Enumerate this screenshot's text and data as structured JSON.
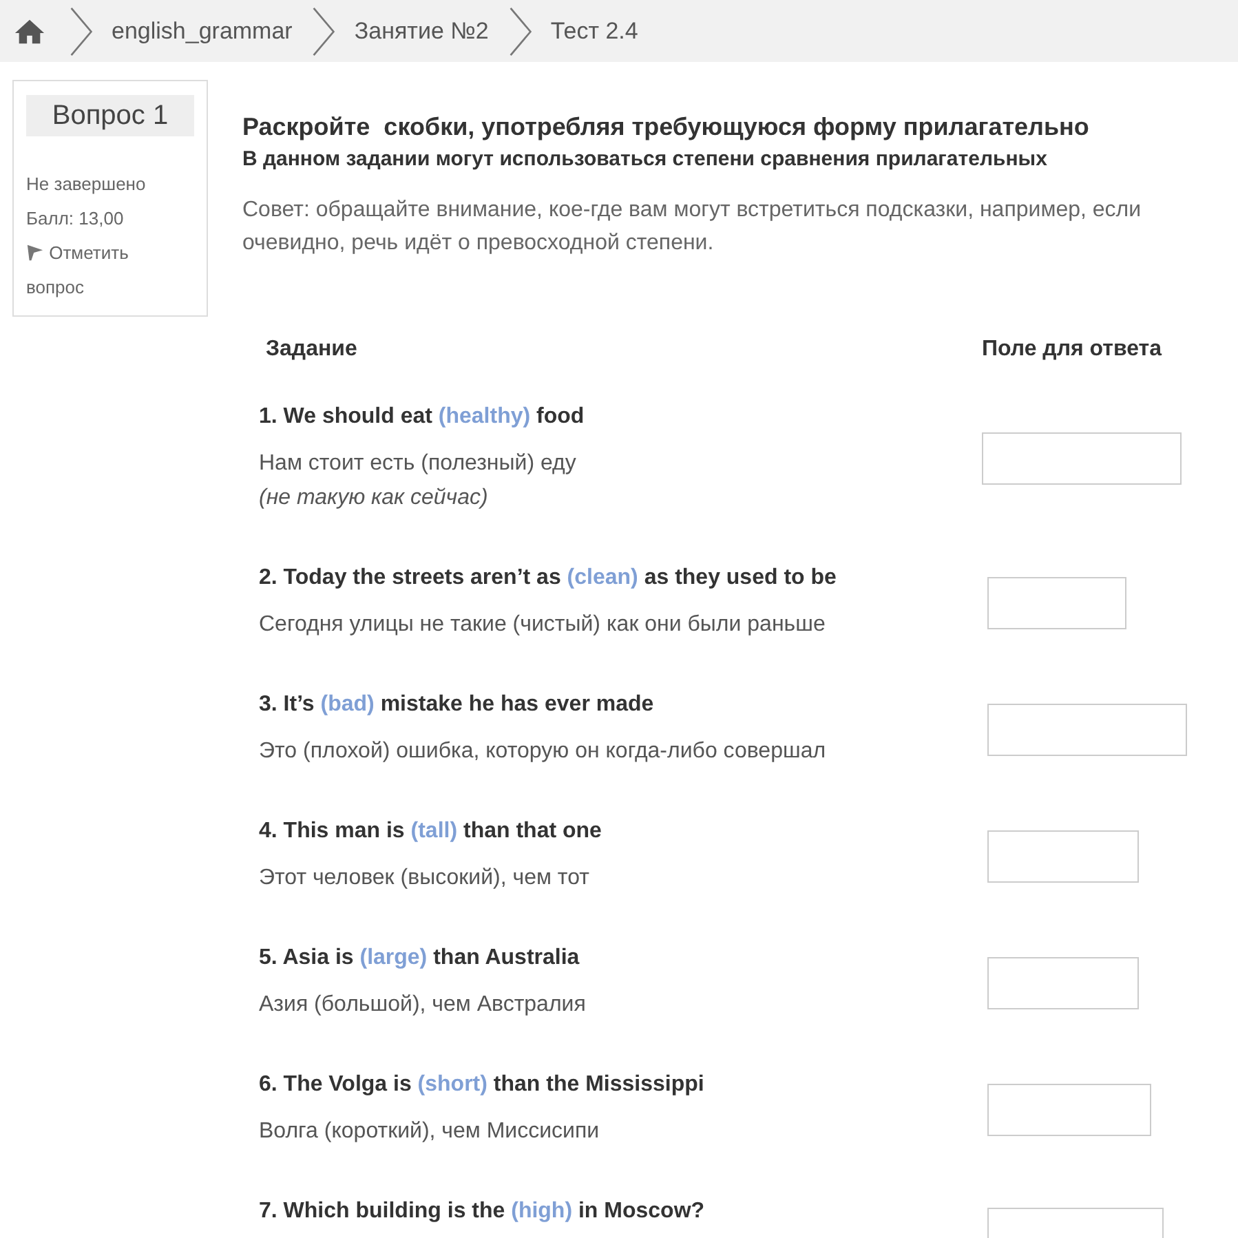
{
  "breadcrumb": {
    "items": [
      {
        "label": "english_grammar"
      },
      {
        "label": "Занятие №2"
      },
      {
        "label": "Тест 2.4"
      }
    ]
  },
  "question_info": {
    "title": "Вопрос 1",
    "state": "Не завершено",
    "grade": "Балл: 13,00",
    "flag_label": "Отметить вопрос",
    "flagged": false
  },
  "instructions": {
    "title": "Раскройте  скобки, употребляя требующуюся форму прилагательно",
    "subtitle": "В данном задании могут использоваться степени сравнения прилагательных",
    "hint_lines": [
      "Совет: обращайте внимание, кое-где вам могут встретиться подсказки, например, если",
      "очевидно, речь идёт о превосходной степени."
    ]
  },
  "table": {
    "columns": [
      "Задание",
      "Поле для ответа"
    ],
    "rows": [
      {
        "before": "1. We should eat ",
        "word": "(healthy)",
        "after": " food",
        "translation": "Нам стоит есть (полезный) еду",
        "note": "(не такую как сейчас)"
      },
      {
        "before": "2. Today the streets aren’t as ",
        "word": "(clean)",
        "after": " as they used to be",
        "translation": "Сегодня улицы не такие (чистый) как они были раньше"
      },
      {
        "before": "3. It’s ",
        "word": "(bad)",
        "after": " mistake he has ever made",
        "translation": "Это (плохой) ошибка, которую он когда-либо совершал"
      },
      {
        "before": "4. This man is ",
        "word": "(tall)",
        "after": " than that one",
        "translation": "Этот человек (высокий), чем тот"
      },
      {
        "before": "5. Asia is ",
        "word": "(large)",
        "after": " than Australia",
        "translation": "Азия (большой), чем Австралия"
      },
      {
        "before": "6. The Volga is ",
        "word": "(short)",
        "after": " than the Mississippi",
        "translation": "Волга (короткий), чем Миссисипи"
      },
      {
        "before": "7. Which building is the ",
        "word": "(high)",
        "after": " in Moscow?"
      }
    ]
  }
}
